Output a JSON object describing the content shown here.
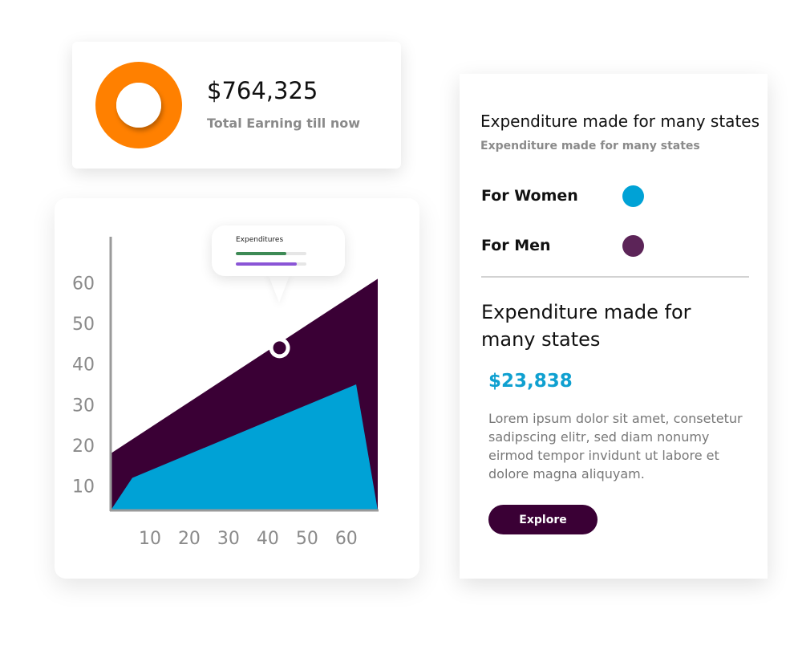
{
  "earnings": {
    "amount": "$764,325",
    "label": "Total Earning till now",
    "donut_color": "#ff8000"
  },
  "tooltip": {
    "title": "Expenditures",
    "bars": [
      {
        "color": "#3d8a55",
        "fraction": 0.72
      },
      {
        "color": "#8a55d6",
        "fraction": 0.86
      }
    ]
  },
  "chart_data": {
    "type": "area",
    "title": "",
    "xlabel": "",
    "ylabel": "",
    "x_ticks": [
      10,
      20,
      30,
      40,
      50,
      60
    ],
    "y_ticks": [
      10,
      20,
      30,
      40,
      50,
      60
    ],
    "xlim": [
      0,
      68
    ],
    "ylim": [
      4,
      66
    ],
    "grid": false,
    "series": [
      {
        "color": "#3a0035",
        "x": [
          0,
          68
        ],
        "y": [
          18,
          61
        ]
      },
      {
        "color": "#00a2d6",
        "x": [
          0,
          5.5,
          62.5,
          68
        ],
        "y": [
          4,
          12,
          35,
          4
        ]
      }
    ],
    "highlight_point": {
      "x": 43,
      "y": 44
    }
  },
  "info": {
    "title": "Expenditure made for many states",
    "subtitle": "Expenditure made for many states",
    "legend": [
      {
        "label": "For Women",
        "color": "#00a2d6"
      },
      {
        "label": "For Men",
        "color": "#5c2458"
      }
    ],
    "heading": "Expenditure made for many states",
    "value": "$23,838",
    "body": "Lorem ipsum dolor sit amet, consetetur sadipscing elitr, sed diam nonumy eirmod tempor invidunt ut labore et dolore magna aliquyam.",
    "button_label": "Explore"
  }
}
